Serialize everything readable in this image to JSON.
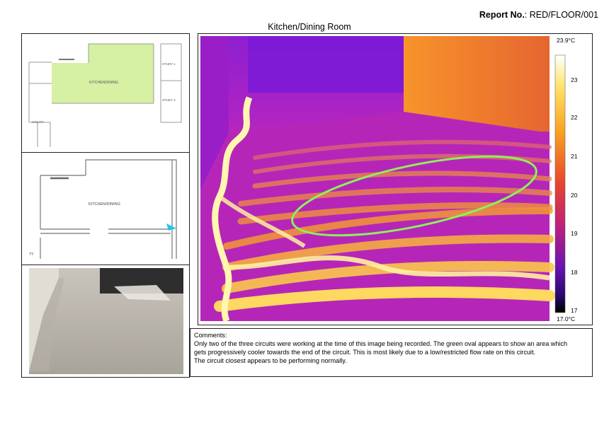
{
  "header": {
    "report_no_label": "Report No.",
    "report_no_value": ": RED/FLOOR/001"
  },
  "title": "Kitchen/Dining Room",
  "floorplan_top": {
    "labels": {
      "kitchen": "KITCHEN/DINING",
      "study1": "STUDY 1",
      "study2": "STUDY 2",
      "utility": "UTILITY"
    },
    "highlight_color": "#d6f0a4"
  },
  "floorplan_detail": {
    "labels": {
      "kitchen": "KITCHEN/DINING",
      "corner": "TY"
    },
    "camera_color": "#20c7e0"
  },
  "thermal": {
    "scale_max": "23.9°C",
    "scale_min": "17.0°C",
    "ticks": [
      "23",
      "22",
      "21",
      "20",
      "19",
      "18",
      "17"
    ],
    "oval_color": "#8ef05a"
  },
  "comments": {
    "heading": "Comments:",
    "lines": [
      "Only two of the three circuits were working at the time of this image being recorded. The green oval appears to show an area which",
      "gets progressively cooler towards the end of the circuit. This is most likely due to a low/restricted flow rate on this circuit.",
      "The circuit closest appears to be performing normally."
    ]
  }
}
